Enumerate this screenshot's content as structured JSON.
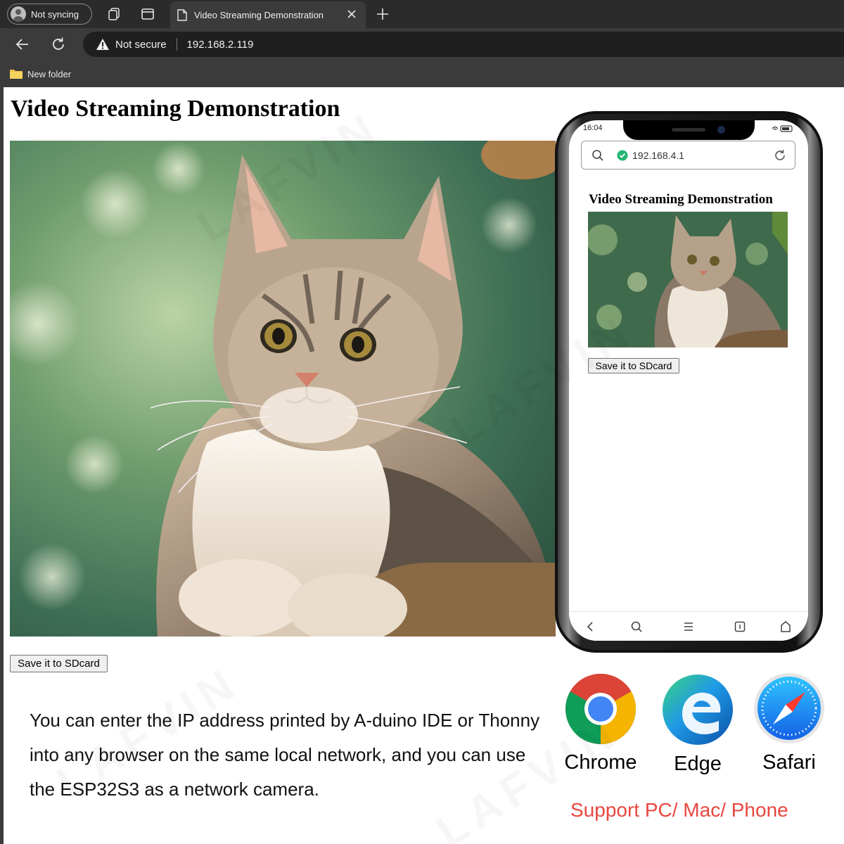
{
  "browser": {
    "profile_label": "Not syncing",
    "tab_title": "Video Streaming Demonstration",
    "security_label": "Not secure",
    "url": "192.168.2.119",
    "bookmark_folder": "New folder"
  },
  "page": {
    "title": "Video Streaming Demonstration",
    "save_button": "Save it to SDcard"
  },
  "description": "You can enter the IP address printed by A-duino IDE or Thonny into any browser on the same local network, and you can use the ESP32S3 as a network camera.",
  "phone": {
    "time": "16:04",
    "url": "192.168.4.1",
    "page_title": "Video Streaming Demonstration",
    "save_button": "Save it to SDcard"
  },
  "browsers": [
    {
      "name": "Chrome",
      "icon": "chrome-logo"
    },
    {
      "name": "Edge",
      "icon": "edge-logo"
    },
    {
      "name": "Safari",
      "icon": "safari-logo"
    }
  ],
  "support_text": "Support PC/ Mac/ Phone",
  "watermark": "LAFVIN",
  "colors": {
    "chrome_dark": "#2b2b2b",
    "toolbar": "#3b3b3b",
    "support_red": "#e8473f",
    "secure_green": "#22b573"
  }
}
